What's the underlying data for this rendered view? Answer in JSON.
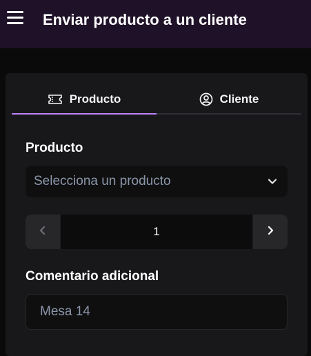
{
  "header": {
    "menu_icon": "hamburger-menu-icon",
    "title": "Enviar producto a un cliente"
  },
  "tabs": [
    {
      "label": "Producto",
      "icon": "ticket-icon",
      "active": true
    },
    {
      "label": "Cliente",
      "icon": "user-circle-icon",
      "active": false
    }
  ],
  "product": {
    "label": "Producto",
    "placeholder": "Selecciona un producto"
  },
  "quantity": {
    "value": "1"
  },
  "comment": {
    "label": "Comentario adicional",
    "placeholder": "Mesa 14"
  },
  "colors": {
    "header_bg": "#1f1228",
    "accent": "#c084fc",
    "card_bg": "#18181b",
    "page_bg": "#0a0a0a"
  }
}
